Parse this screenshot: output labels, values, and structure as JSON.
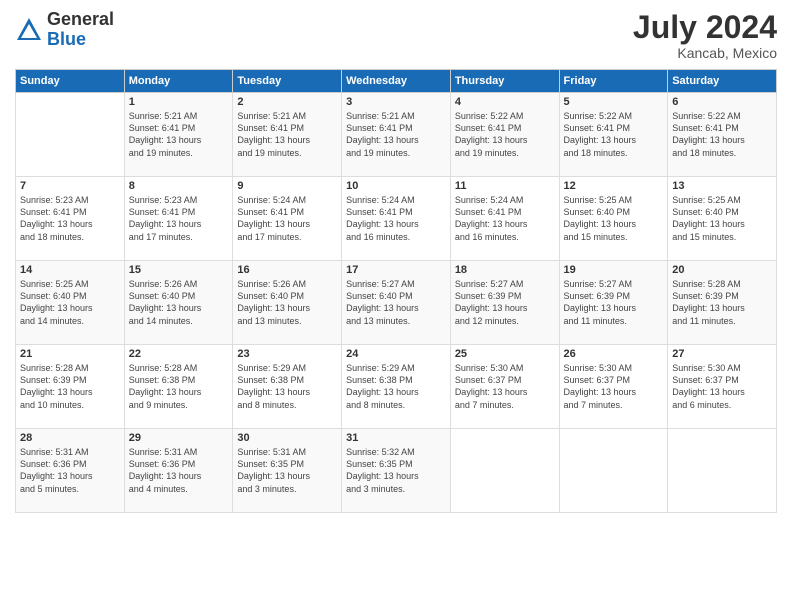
{
  "header": {
    "logo_general": "General",
    "logo_blue": "Blue",
    "month": "July 2024",
    "location": "Kancab, Mexico"
  },
  "calendar": {
    "days_of_week": [
      "Sunday",
      "Monday",
      "Tuesday",
      "Wednesday",
      "Thursday",
      "Friday",
      "Saturday"
    ],
    "weeks": [
      [
        {
          "day": "",
          "info": ""
        },
        {
          "day": "1",
          "info": "Sunrise: 5:21 AM\nSunset: 6:41 PM\nDaylight: 13 hours\nand 19 minutes."
        },
        {
          "day": "2",
          "info": "Sunrise: 5:21 AM\nSunset: 6:41 PM\nDaylight: 13 hours\nand 19 minutes."
        },
        {
          "day": "3",
          "info": "Sunrise: 5:21 AM\nSunset: 6:41 PM\nDaylight: 13 hours\nand 19 minutes."
        },
        {
          "day": "4",
          "info": "Sunrise: 5:22 AM\nSunset: 6:41 PM\nDaylight: 13 hours\nand 19 minutes."
        },
        {
          "day": "5",
          "info": "Sunrise: 5:22 AM\nSunset: 6:41 PM\nDaylight: 13 hours\nand 18 minutes."
        },
        {
          "day": "6",
          "info": "Sunrise: 5:22 AM\nSunset: 6:41 PM\nDaylight: 13 hours\nand 18 minutes."
        }
      ],
      [
        {
          "day": "7",
          "info": "Sunrise: 5:23 AM\nSunset: 6:41 PM\nDaylight: 13 hours\nand 18 minutes."
        },
        {
          "day": "8",
          "info": "Sunrise: 5:23 AM\nSunset: 6:41 PM\nDaylight: 13 hours\nand 17 minutes."
        },
        {
          "day": "9",
          "info": "Sunrise: 5:24 AM\nSunset: 6:41 PM\nDaylight: 13 hours\nand 17 minutes."
        },
        {
          "day": "10",
          "info": "Sunrise: 5:24 AM\nSunset: 6:41 PM\nDaylight: 13 hours\nand 16 minutes."
        },
        {
          "day": "11",
          "info": "Sunrise: 5:24 AM\nSunset: 6:41 PM\nDaylight: 13 hours\nand 16 minutes."
        },
        {
          "day": "12",
          "info": "Sunrise: 5:25 AM\nSunset: 6:40 PM\nDaylight: 13 hours\nand 15 minutes."
        },
        {
          "day": "13",
          "info": "Sunrise: 5:25 AM\nSunset: 6:40 PM\nDaylight: 13 hours\nand 15 minutes."
        }
      ],
      [
        {
          "day": "14",
          "info": "Sunrise: 5:25 AM\nSunset: 6:40 PM\nDaylight: 13 hours\nand 14 minutes."
        },
        {
          "day": "15",
          "info": "Sunrise: 5:26 AM\nSunset: 6:40 PM\nDaylight: 13 hours\nand 14 minutes."
        },
        {
          "day": "16",
          "info": "Sunrise: 5:26 AM\nSunset: 6:40 PM\nDaylight: 13 hours\nand 13 minutes."
        },
        {
          "day": "17",
          "info": "Sunrise: 5:27 AM\nSunset: 6:40 PM\nDaylight: 13 hours\nand 13 minutes."
        },
        {
          "day": "18",
          "info": "Sunrise: 5:27 AM\nSunset: 6:39 PM\nDaylight: 13 hours\nand 12 minutes."
        },
        {
          "day": "19",
          "info": "Sunrise: 5:27 AM\nSunset: 6:39 PM\nDaylight: 13 hours\nand 11 minutes."
        },
        {
          "day": "20",
          "info": "Sunrise: 5:28 AM\nSunset: 6:39 PM\nDaylight: 13 hours\nand 11 minutes."
        }
      ],
      [
        {
          "day": "21",
          "info": "Sunrise: 5:28 AM\nSunset: 6:39 PM\nDaylight: 13 hours\nand 10 minutes."
        },
        {
          "day": "22",
          "info": "Sunrise: 5:28 AM\nSunset: 6:38 PM\nDaylight: 13 hours\nand 9 minutes."
        },
        {
          "day": "23",
          "info": "Sunrise: 5:29 AM\nSunset: 6:38 PM\nDaylight: 13 hours\nand 8 minutes."
        },
        {
          "day": "24",
          "info": "Sunrise: 5:29 AM\nSunset: 6:38 PM\nDaylight: 13 hours\nand 8 minutes."
        },
        {
          "day": "25",
          "info": "Sunrise: 5:30 AM\nSunset: 6:37 PM\nDaylight: 13 hours\nand 7 minutes."
        },
        {
          "day": "26",
          "info": "Sunrise: 5:30 AM\nSunset: 6:37 PM\nDaylight: 13 hours\nand 7 minutes."
        },
        {
          "day": "27",
          "info": "Sunrise: 5:30 AM\nSunset: 6:37 PM\nDaylight: 13 hours\nand 6 minutes."
        }
      ],
      [
        {
          "day": "28",
          "info": "Sunrise: 5:31 AM\nSunset: 6:36 PM\nDaylight: 13 hours\nand 5 minutes."
        },
        {
          "day": "29",
          "info": "Sunrise: 5:31 AM\nSunset: 6:36 PM\nDaylight: 13 hours\nand 4 minutes."
        },
        {
          "day": "30",
          "info": "Sunrise: 5:31 AM\nSunset: 6:35 PM\nDaylight: 13 hours\nand 3 minutes."
        },
        {
          "day": "31",
          "info": "Sunrise: 5:32 AM\nSunset: 6:35 PM\nDaylight: 13 hours\nand 3 minutes."
        },
        {
          "day": "",
          "info": ""
        },
        {
          "day": "",
          "info": ""
        },
        {
          "day": "",
          "info": ""
        }
      ]
    ]
  }
}
